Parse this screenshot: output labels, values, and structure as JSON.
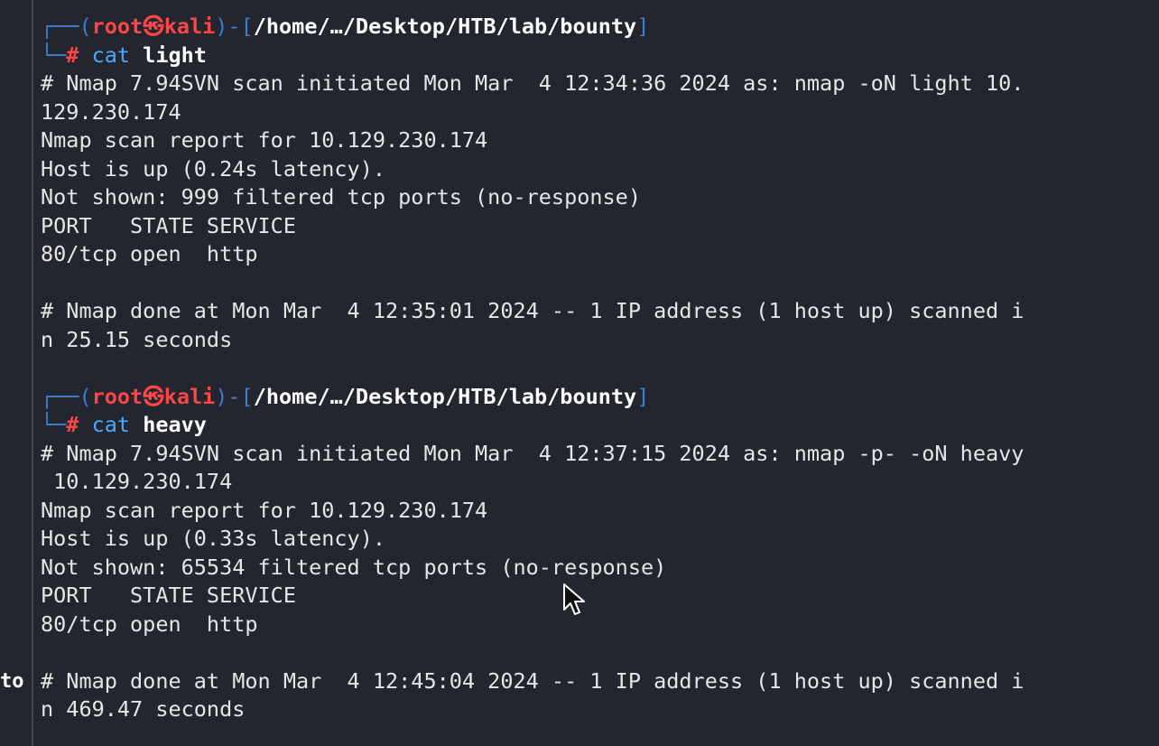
{
  "side_label": "to",
  "blocks": [
    {
      "prompt": {
        "corner_top": "┌──(",
        "user": "root",
        "skull": "㉿",
        "host": "kali",
        "bracket_mid": ")-[",
        "path": "/home/…/Desktop/HTB/lab/bounty",
        "bracket_end": "]",
        "corner_bot": "└─",
        "hash": "#",
        "command": "cat",
        "argument": "light"
      },
      "output": [
        "# Nmap 7.94SVN scan initiated Mon Mar  4 12:34:36 2024 as: nmap -oN light 10.",
        "129.230.174",
        "Nmap scan report for 10.129.230.174",
        "Host is up (0.24s latency).",
        "Not shown: 999 filtered tcp ports (no-response)",
        "PORT   STATE SERVICE",
        "80/tcp open  http",
        "",
        "# Nmap done at Mon Mar  4 12:35:01 2024 -- 1 IP address (1 host up) scanned i",
        "n 25.15 seconds",
        ""
      ]
    },
    {
      "prompt": {
        "corner_top": "┌──(",
        "user": "root",
        "skull": "㉿",
        "host": "kali",
        "bracket_mid": ")-[",
        "path": "/home/…/Desktop/HTB/lab/bounty",
        "bracket_end": "]",
        "corner_bot": "└─",
        "hash": "#",
        "command": "cat",
        "argument": "heavy"
      },
      "output": [
        "# Nmap 7.94SVN scan initiated Mon Mar  4 12:37:15 2024 as: nmap -p- -oN heavy",
        " 10.129.230.174",
        "Nmap scan report for 10.129.230.174",
        "Host is up (0.33s latency).",
        "Not shown: 65534 filtered tcp ports (no-response)",
        "PORT   STATE SERVICE",
        "80/tcp open  http",
        "",
        "# Nmap done at Mon Mar  4 12:45:04 2024 -- 1 IP address (1 host up) scanned i",
        "n 469.47 seconds"
      ]
    }
  ]
}
